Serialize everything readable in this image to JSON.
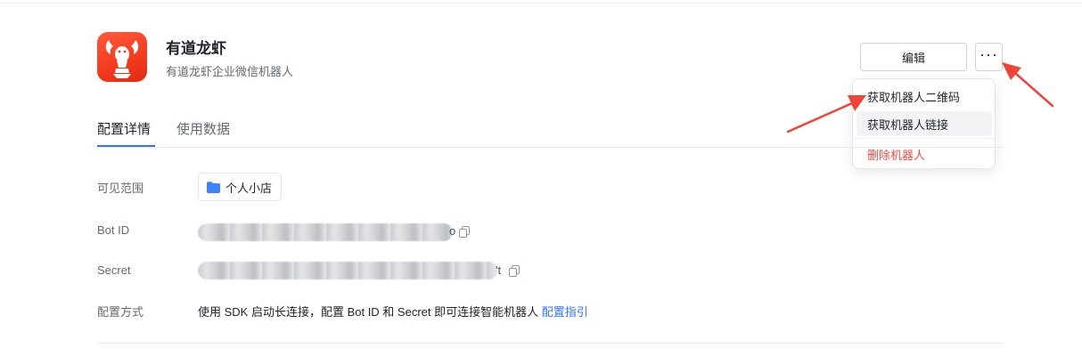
{
  "app": {
    "title": "有道龙虾",
    "subtitle": "有道龙虾企业微信机器人",
    "icon": "lobster-icon",
    "brand_color": "#f23a1f"
  },
  "header_actions": {
    "edit_label": "编辑",
    "more_label": "···"
  },
  "dropdown_menu": {
    "items": [
      {
        "label": "获取机器人二维码"
      },
      {
        "label": "获取机器人链接"
      },
      {
        "label": "删除机器人",
        "color": "#f54a45"
      }
    ]
  },
  "tabs": [
    {
      "label": "配置详情",
      "active": true
    },
    {
      "label": "使用数据",
      "active": false
    }
  ],
  "details": {
    "scope": {
      "label": "可见范围",
      "value": "个人小店",
      "icon": "folder-icon"
    },
    "bot_id": {
      "label": "Bot ID",
      "visible_tail": "o",
      "icon": "copy-icon"
    },
    "secret": {
      "label": "Secret",
      "visible_tail": "'t",
      "icon": "copy-icon"
    },
    "method": {
      "label": "配置方式",
      "text": "使用 SDK 启动长连接，配置 Bot ID 和 Secret 即可连接智能机器人",
      "link": "配置指引"
    }
  },
  "colors": {
    "accent": "#3370ff",
    "danger": "#f54a45",
    "annotation_arrow": "#f04438"
  }
}
